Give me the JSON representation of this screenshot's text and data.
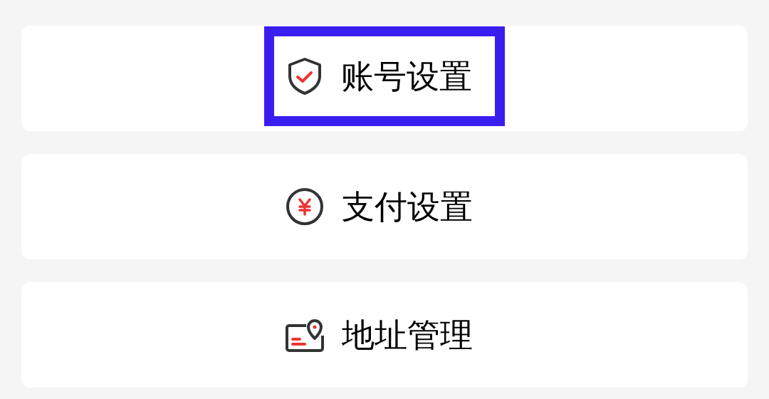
{
  "menu_items": [
    {
      "kind": "account",
      "label": "账号设置",
      "highlighted": true
    },
    {
      "kind": "payment",
      "label": "支付设置",
      "highlighted": false
    },
    {
      "kind": "address",
      "label": "地址管理",
      "highlighted": false
    }
  ]
}
